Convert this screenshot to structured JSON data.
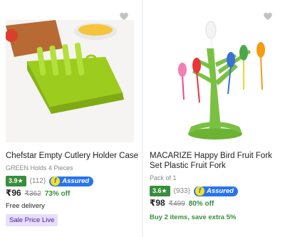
{
  "products": [
    {
      "title": "Chefstar Empty Cutlery Holder Case",
      "subtitle": "GREEN Holds 4 Pieces",
      "rating": "3.9★",
      "rating_count": "(112)",
      "assured_label": "Assured",
      "assured_logo": "f",
      "price": "₹96",
      "mrp": "₹362",
      "discount": "73% off",
      "delivery": "Free delivery",
      "badge": "Sale Price Live",
      "colors": {
        "product": "#a6d62b",
        "badge_bg": "#e8deff"
      }
    },
    {
      "title": "MACARIZE Happy Bird Fruit Fork Set Plastic Fruit Fork",
      "subtitle": "Pack of 1",
      "rating": "3.6★",
      "rating_count": "(933)",
      "assured_label": "Assured",
      "assured_logo": "f",
      "price": "₹98",
      "mrp": "₹499",
      "discount": "80% off",
      "offer": "Buy 2 items, save extra 5%",
      "colors": {
        "product": "#7ac143"
      }
    }
  ],
  "icons": {
    "wishlist": "heart-icon"
  },
  "colors": {
    "rating_green": "#388e3c",
    "assured_blue": "#2874f0",
    "offer_green": "#388e3c"
  }
}
